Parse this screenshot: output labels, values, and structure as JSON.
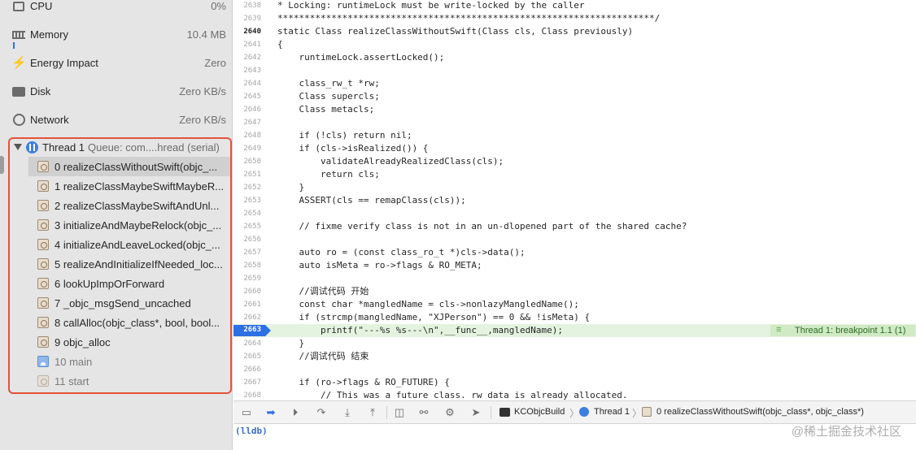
{
  "gauges": [
    {
      "label": "CPU",
      "value": "0%",
      "icon": "cpu-icon"
    },
    {
      "label": "Memory",
      "value": "10.4 MB",
      "icon": "memory-icon"
    },
    {
      "label": "Energy Impact",
      "value": "Zero",
      "icon": "bolt-icon"
    },
    {
      "label": "Disk",
      "value": "Zero KB/s",
      "icon": "disk-icon"
    },
    {
      "label": "Network",
      "value": "Zero KB/s",
      "icon": "globe-icon"
    }
  ],
  "thread": {
    "name": "Thread 1",
    "queue": "Queue: com....hread (serial)",
    "frames": [
      "0 realizeClassWithoutSwift(objc_...",
      "1 realizeClassMaybeSwiftMaybeR...",
      "2 realizeClassMaybeSwiftAndUnl...",
      "3 initializeAndMaybeRelock(objc_...",
      "4 initializeAndLeaveLocked(objc_...",
      "5 realizeAndInitializeIfNeeded_loc...",
      "6 lookUpImpOrForward",
      "7 _objc_msgSend_uncached",
      "8 callAlloc(objc_class*, bool, bool...",
      "9 objc_alloc",
      "10 main",
      "11 start"
    ]
  },
  "editor": {
    "current_line": "2663",
    "breakpoint_annotation": "Thread 1: breakpoint 1.1 (1)",
    "lines": [
      {
        "n": "2638",
        "t": "* Locking: runtimeLock must be write-locked by the caller"
      },
      {
        "n": "2639",
        "t": "**********************************************************************/"
      },
      {
        "n": "2640",
        "t": "static Class realizeClassWithoutSwift(Class cls, Class previously)"
      },
      {
        "n": "2641",
        "t": "{"
      },
      {
        "n": "2642",
        "t": "    runtimeLock.assertLocked();"
      },
      {
        "n": "2643",
        "t": ""
      },
      {
        "n": "2644",
        "t": "    class_rw_t *rw;"
      },
      {
        "n": "2645",
        "t": "    Class supercls;"
      },
      {
        "n": "2646",
        "t": "    Class metacls;"
      },
      {
        "n": "2647",
        "t": ""
      },
      {
        "n": "2648",
        "t": "    if (!cls) return nil;"
      },
      {
        "n": "2649",
        "t": "    if (cls->isRealized()) {"
      },
      {
        "n": "2650",
        "t": "        validateAlreadyRealizedClass(cls);"
      },
      {
        "n": "2651",
        "t": "        return cls;"
      },
      {
        "n": "2652",
        "t": "    }"
      },
      {
        "n": "2653",
        "t": "    ASSERT(cls == remapClass(cls));"
      },
      {
        "n": "2654",
        "t": ""
      },
      {
        "n": "2655",
        "t": "    // fixme verify class is not in an un-dlopened part of the shared cache?"
      },
      {
        "n": "2656",
        "t": ""
      },
      {
        "n": "2657",
        "t": "    auto ro = (const class_ro_t *)cls->data();"
      },
      {
        "n": "2658",
        "t": "    auto isMeta = ro->flags & RO_META;"
      },
      {
        "n": "2659",
        "t": ""
      },
      {
        "n": "2660",
        "t": "    //调试代码 开始"
      },
      {
        "n": "2661",
        "t": "    const char *mangledName = cls->nonlazyMangledName();"
      },
      {
        "n": "2662",
        "t": "    if (strcmp(mangledName, \"XJPerson\") == 0 && !isMeta) {"
      },
      {
        "n": "2663",
        "t": "        printf(\"---%s %s---\\n\",__func__,mangledName);"
      },
      {
        "n": "2664",
        "t": "    }"
      },
      {
        "n": "2665",
        "t": "    //调试代码 结束"
      },
      {
        "n": "2666",
        "t": ""
      },
      {
        "n": "2667",
        "t": "    if (ro->flags & RO_FUTURE) {"
      },
      {
        "n": "2668",
        "t": "        // This was a future class. rw data is already allocated."
      }
    ]
  },
  "debugbar": {
    "crumbs": [
      "KCObjcBuild",
      "Thread 1",
      "0 realizeClassWithoutSwift(objc_class*, objc_class*)"
    ]
  },
  "console": {
    "prompt": "(lldb)"
  },
  "watermark": "@稀土掘金技术社区"
}
